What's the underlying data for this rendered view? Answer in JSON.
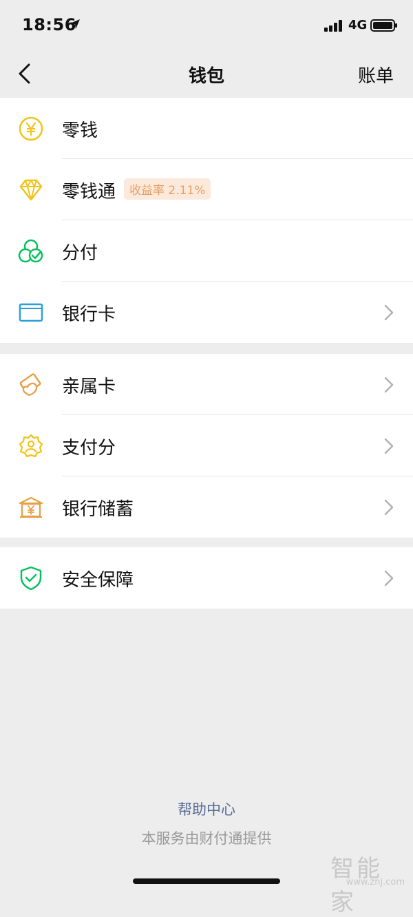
{
  "status_bar": {
    "time": "18:56",
    "network": "4G"
  },
  "nav": {
    "title": "钱包",
    "right_link": "账单"
  },
  "groups": [
    {
      "items": [
        {
          "label": "零钱",
          "icon": "yen-coin-icon"
        },
        {
          "label": "零钱通",
          "icon": "diamond-icon",
          "badge": "收益率 2.11%"
        },
        {
          "label": "分付",
          "icon": "fenfu-icon"
        },
        {
          "label": "银行卡",
          "icon": "bank-card-icon"
        }
      ]
    },
    {
      "items": [
        {
          "label": "亲属卡",
          "icon": "family-card-icon"
        },
        {
          "label": "支付分",
          "icon": "pay-score-icon"
        },
        {
          "label": "银行储蓄",
          "icon": "bank-savings-icon"
        }
      ]
    },
    {
      "items": [
        {
          "label": "安全保障",
          "icon": "shield-icon"
        }
      ]
    }
  ],
  "footer": {
    "help": "帮助中心",
    "note": "本服务由财付通提供"
  },
  "watermark": {
    "logo": "智能家",
    "url": "www.znj.com"
  },
  "colors": {
    "yellow": "#f2c318",
    "green": "#07c160",
    "blue": "#2aa0d8",
    "orange": "#e8a048",
    "badge_bg": "#fbe9db",
    "badge_text": "#e8a063",
    "link": "#576b95"
  }
}
